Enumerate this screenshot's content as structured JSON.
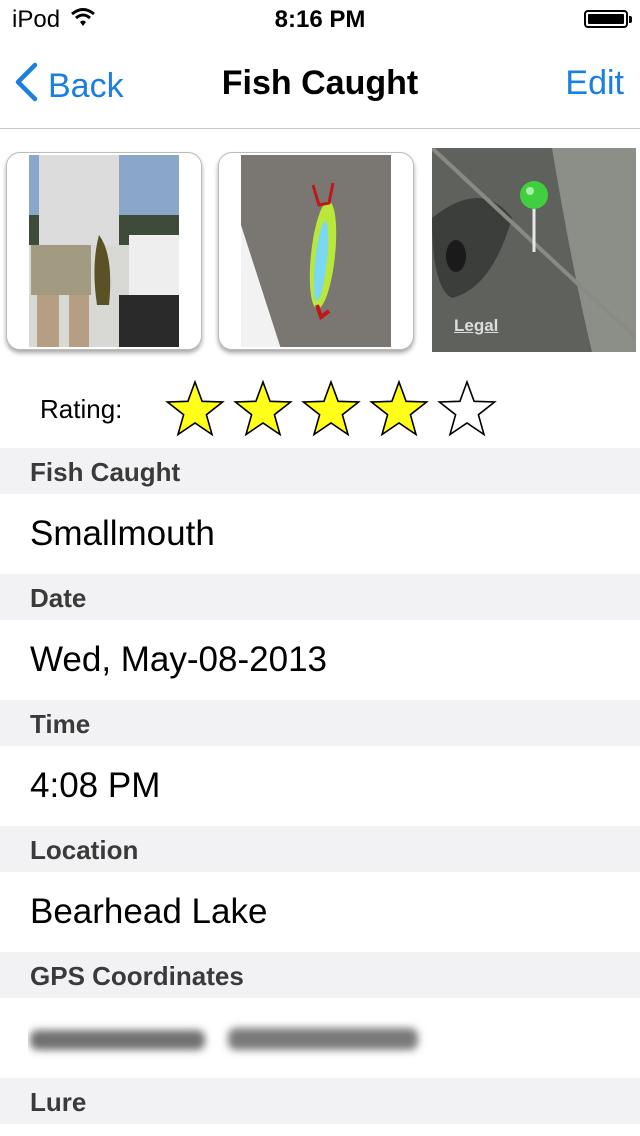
{
  "status_bar": {
    "carrier": "iPod",
    "time": "8:16 PM"
  },
  "nav": {
    "back_label": "Back",
    "title": "Fish Caught",
    "edit_label": "Edit"
  },
  "map": {
    "legal_label": "Legal"
  },
  "rating": {
    "label": "Rating:",
    "value": 4,
    "max": 5
  },
  "details": {
    "fish_caught": {
      "header": "Fish Caught",
      "value": "Smallmouth"
    },
    "date": {
      "header": "Date",
      "value": "Wed, May-08-2013"
    },
    "time": {
      "header": "Time",
      "value": "4:08 PM"
    },
    "location": {
      "header": "Location",
      "value": "Bearhead Lake"
    },
    "gps": {
      "header": "GPS Coordinates"
    },
    "lure": {
      "header": "Lure"
    }
  },
  "colors": {
    "accent": "#1a7fe0",
    "star_fill": "#ffff1a",
    "section_bg": "#f2f2f4",
    "map_pin": "#3fcf3f"
  }
}
